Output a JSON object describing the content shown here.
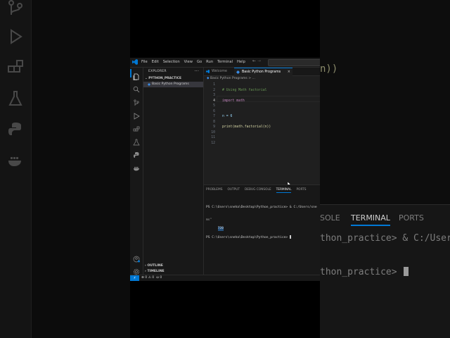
{
  "background": {
    "right_top_text": "n))",
    "right_panel_tabs": [
      "SOLE",
      "TERMINAL",
      "PORTS"
    ],
    "right_line1": "thon_practice> & C:/Users/sne",
    "right_line2": "thon_practice>"
  },
  "menu": [
    "File",
    "Edit",
    "Selection",
    "View",
    "Go",
    "Run",
    "Terminal",
    "Help"
  ],
  "explorer": {
    "title": "EXPLORER",
    "more": "···",
    "folder": "PYTHON_PRACTICE",
    "file": "Basic Python Programs",
    "outline": "OUTLINE",
    "timeline": "TIMELINE"
  },
  "tabs": {
    "welcome": "Welcome",
    "active": "Basic Python Programs",
    "close": "×"
  },
  "breadcrumb": "Basic Python Programs > ...",
  "code": [
    {
      "n": "1",
      "t": ""
    },
    {
      "n": "2",
      "t": "# Using Math factorial"
    },
    {
      "n": "3",
      "t": ""
    },
    {
      "n": "4",
      "t": "import math"
    },
    {
      "n": "5",
      "t": ""
    },
    {
      "n": "6",
      "t": ""
    },
    {
      "n": "7",
      "t": "n = 6"
    },
    {
      "n": "8",
      "t": ""
    },
    {
      "n": "9",
      "t": "print(math.factorial(n))"
    },
    {
      "n": "10",
      "t": ""
    },
    {
      "n": "11",
      "t": ""
    },
    {
      "n": "12",
      "t": ""
    }
  ],
  "panel": {
    "tabs": [
      "PROBLEMS",
      "OUTPUT",
      "DEBUG CONSOLE",
      "TERMINAL",
      "PORTS"
    ],
    "active_tab": "TERMINAL",
    "term_line1": "PS C:\\Users\\sneha\\Desktop\\Python_practice> & C:/Users/sne",
    "term_line1b": "ms\"",
    "term_output": "720",
    "term_line3": "PS C:\\Users\\sneha\\Desktop\\Python_practice> "
  },
  "status": {
    "remote": "⚡",
    "problems": "⊗ 0 ⚠ 0",
    "ports": "⛀ 0"
  },
  "colors": {
    "accent": "#0078d4",
    "keyword": "#c586c0",
    "module": "#4ec9b0",
    "comment": "#6a9955",
    "function": "#dcdcaa",
    "variable": "#9cdcfe",
    "number": "#b5cea8"
  }
}
